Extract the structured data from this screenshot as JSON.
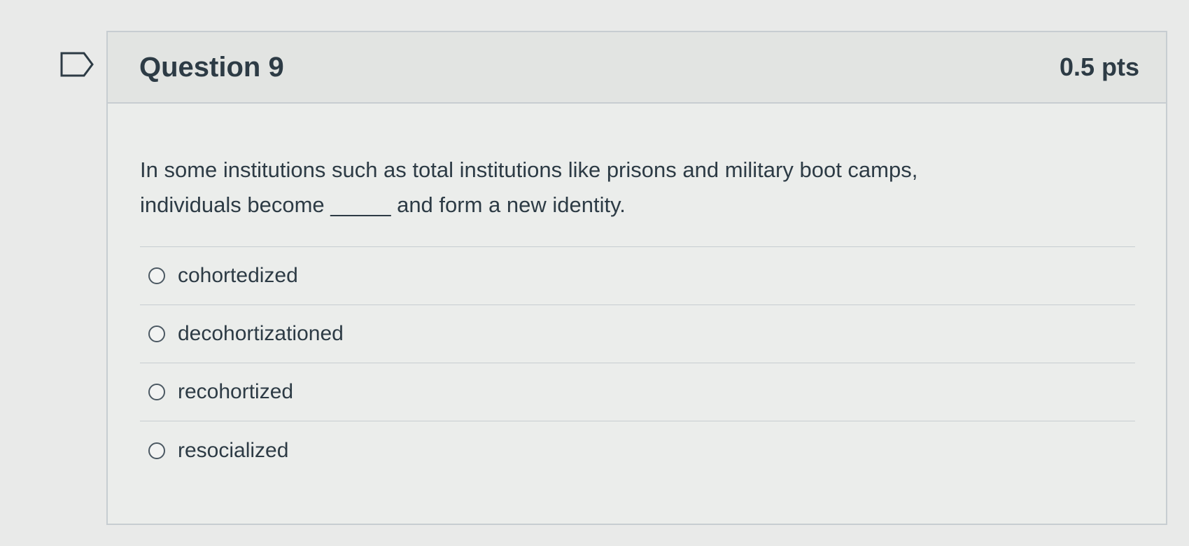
{
  "question": {
    "title": "Question 9",
    "points": "0.5 pts",
    "text_line1": "In some institutions such as total institutions like prisons and military boot camps,",
    "text_line2": "individuals become _____ and form a new identity.",
    "flag_icon": "flag-icon"
  },
  "answers": [
    {
      "label": "cohortedized"
    },
    {
      "label": "decohortizationed"
    },
    {
      "label": "recohortized"
    },
    {
      "label": "resocialized"
    }
  ],
  "colors": {
    "text": "#2d3b45",
    "border": "#c7cdd1",
    "header_bg": "#e2e4e2",
    "page_bg": "#e9eae9"
  }
}
